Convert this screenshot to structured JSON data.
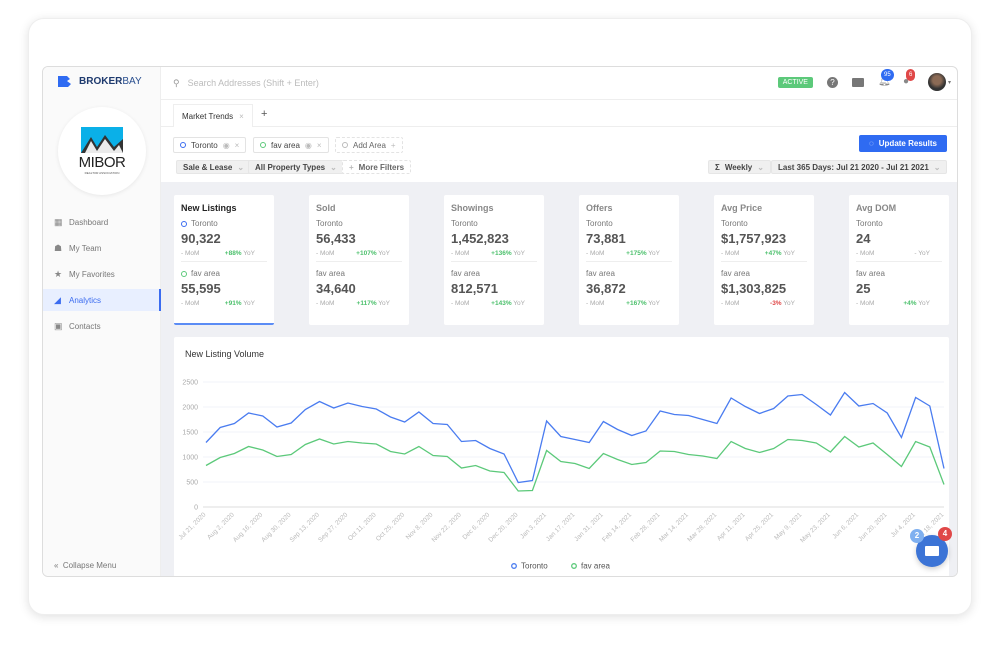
{
  "brand": {
    "name_bold": "BROKER",
    "name_light": "BAY",
    "org_logo": "MIBOR",
    "org_sub": "REALTOR ASSOCIATION"
  },
  "sidebar": {
    "items": [
      {
        "label": "Dashboard",
        "icon": "grid-icon"
      },
      {
        "label": "My Team",
        "icon": "team-icon"
      },
      {
        "label": "My Favorites",
        "icon": "star-icon"
      },
      {
        "label": "Analytics",
        "icon": "chart-icon",
        "active": true
      },
      {
        "label": "Contacts",
        "icon": "contact-icon"
      }
    ],
    "collapse": "Collapse Menu"
  },
  "header": {
    "search_placeholder": "Search Addresses (Shift + Enter)",
    "status": "ACTIVE",
    "notifications": "95",
    "messages": "6"
  },
  "tabs": [
    {
      "label": "Market Trends"
    }
  ],
  "filters": {
    "areas": [
      "Toronto",
      "fav area"
    ],
    "add_area": "Add Area",
    "sale_type": "Sale & Lease",
    "property_types": "All Property Types",
    "more_filters": "More Filters",
    "update": "Update Results",
    "interval": "Weekly",
    "range": "Last 365 Days: Jul 21 2020 - Jul 21 2021"
  },
  "colors": {
    "toronto": "#4a7cf0",
    "fav_area": "#5cc97a",
    "accent": "#2f6bf2"
  },
  "cards": [
    {
      "title": "New Listings",
      "a": {
        "area": "Toronto",
        "value": "90,322",
        "mom": "- MoM",
        "yoy": "+88%"
      },
      "b": {
        "area": "fav area",
        "value": "55,595",
        "mom": "- MoM",
        "yoy": "+91%"
      }
    },
    {
      "title": "Sold",
      "a": {
        "area": "Toronto",
        "value": "56,433",
        "mom": "- MoM",
        "yoy": "+107%"
      },
      "b": {
        "area": "fav area",
        "value": "34,640",
        "mom": "- MoM",
        "yoy": "+117%"
      }
    },
    {
      "title": "Showings",
      "a": {
        "area": "Toronto",
        "value": "1,452,823",
        "mom": "- MoM",
        "yoy": "+136%"
      },
      "b": {
        "area": "fav area",
        "value": "812,571",
        "mom": "- MoM",
        "yoy": "+143%"
      }
    },
    {
      "title": "Offers",
      "a": {
        "area": "Toronto",
        "value": "73,881",
        "mom": "- MoM",
        "yoy": "+175%"
      },
      "b": {
        "area": "fav area",
        "value": "36,872",
        "mom": "- MoM",
        "yoy": "+167%"
      }
    },
    {
      "title": "Avg Price",
      "a": {
        "area": "Toronto",
        "value": "$1,757,923",
        "mom": "- MoM",
        "yoy": "+47%"
      },
      "b": {
        "area": "fav area",
        "value": "$1,303,825",
        "mom": "- MoM",
        "yoy": "-3%"
      }
    },
    {
      "title": "Avg DOM",
      "a": {
        "area": "Toronto",
        "value": "24",
        "mom": "- MoM",
        "yoy": "-"
      },
      "b": {
        "area": "fav area",
        "value": "25",
        "mom": "- MoM",
        "yoy": "+4%"
      }
    }
  ],
  "yoy_suffix": "YoY",
  "chat": {
    "left_badge": "2",
    "right_badge": "4"
  },
  "chart_data": {
    "type": "line",
    "title": "New Listing Volume",
    "ylim": [
      0,
      2500
    ],
    "yticks": [
      0,
      500,
      1000,
      1500,
      2000,
      2500
    ],
    "grid": true,
    "legend": "bottom",
    "x_ticks": [
      "Jul 21, 2020",
      "Aug 2, 2020",
      "Aug 16, 2020",
      "Aug 30, 2020",
      "Sep 13, 2020",
      "Sep 27, 2020",
      "Oct 11, 2020",
      "Oct 25, 2020",
      "Nov 8, 2020",
      "Nov 22, 2020",
      "Dec 6, 2020",
      "Dec 20, 2020",
      "Jan 3, 2021",
      "Jan 17, 2021",
      "Jan 31, 2021",
      "Feb 14, 2021",
      "Feb 28, 2021",
      "Mar 14, 2021",
      "Mar 28, 2021",
      "Apr 11, 2021",
      "Apr 25, 2021",
      "May 9, 2021",
      "May 23, 2021",
      "Jun 6, 2021",
      "Jun 20, 2021",
      "Jul 4, 2021",
      "Jul 18, 2021"
    ],
    "series": [
      {
        "name": "Toronto",
        "color": "#4a7cf0",
        "values": [
          1290,
          1590,
          1670,
          1880,
          1820,
          1600,
          1680,
          1950,
          2110,
          1980,
          2080,
          2010,
          1960,
          1800,
          1700,
          1900,
          1670,
          1650,
          1310,
          1330,
          1170,
          1060,
          490,
          530,
          1720,
          1410,
          1350,
          1290,
          1710,
          1550,
          1430,
          1520,
          1920,
          1850,
          1830,
          1750,
          1670,
          2180,
          2010,
          1870,
          1970,
          2220,
          2250,
          2050,
          1840,
          2290,
          2020,
          2070,
          1880,
          1390,
          2190,
          2020,
          770
        ]
      },
      {
        "name": "fav area",
        "color": "#5cc97a",
        "values": [
          830,
          990,
          1070,
          1210,
          1140,
          1010,
          1050,
          1250,
          1360,
          1260,
          1310,
          1280,
          1260,
          1110,
          1060,
          1210,
          1030,
          1010,
          780,
          830,
          720,
          690,
          320,
          330,
          1130,
          910,
          870,
          770,
          1070,
          950,
          850,
          890,
          1120,
          1110,
          1050,
          1020,
          970,
          1310,
          1170,
          1090,
          1170,
          1350,
          1330,
          1280,
          1100,
          1410,
          1200,
          1280,
          1050,
          810,
          1310,
          1200,
          450
        ]
      }
    ]
  }
}
